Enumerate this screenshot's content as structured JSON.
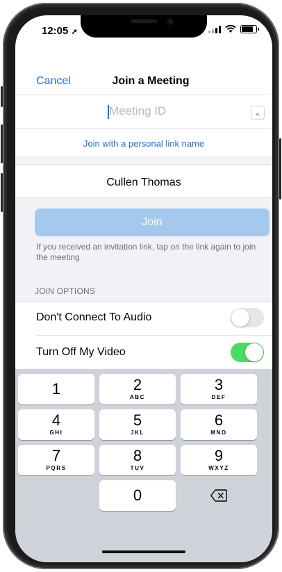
{
  "status_bar": {
    "time": "12:05"
  },
  "nav": {
    "cancel_label": "Cancel",
    "title": "Join a Meeting"
  },
  "meeting_id": {
    "placeholder": "Meeting ID"
  },
  "personal_link_label": "Join with a personal link name",
  "name_value": "Cullen Thomas",
  "join_label": "Join",
  "hint_text": "If you received an invitation link, tap on the link again to join the meeting",
  "options_header": "JOIN OPTIONS",
  "options": [
    {
      "label": "Don't Connect To Audio",
      "enabled": false
    },
    {
      "label": "Turn Off My Video",
      "enabled": true
    }
  ],
  "keypad": [
    {
      "num": "1",
      "letters": ""
    },
    {
      "num": "2",
      "letters": "ABC"
    },
    {
      "num": "3",
      "letters": "DEF"
    },
    {
      "num": "4",
      "letters": "GHI"
    },
    {
      "num": "5",
      "letters": "JKL"
    },
    {
      "num": "6",
      "letters": "MNO"
    },
    {
      "num": "7",
      "letters": "PQRS"
    },
    {
      "num": "8",
      "letters": "TUV"
    },
    {
      "num": "9",
      "letters": "WXYZ"
    },
    {
      "num": "0",
      "letters": ""
    }
  ],
  "colors": {
    "accent": "#2a6fc9",
    "join_disabled": "#a5c9ec",
    "toggle_on": "#4cd964",
    "toggle_off": "#e6e6ea"
  },
  "battery_level": 0.8
}
